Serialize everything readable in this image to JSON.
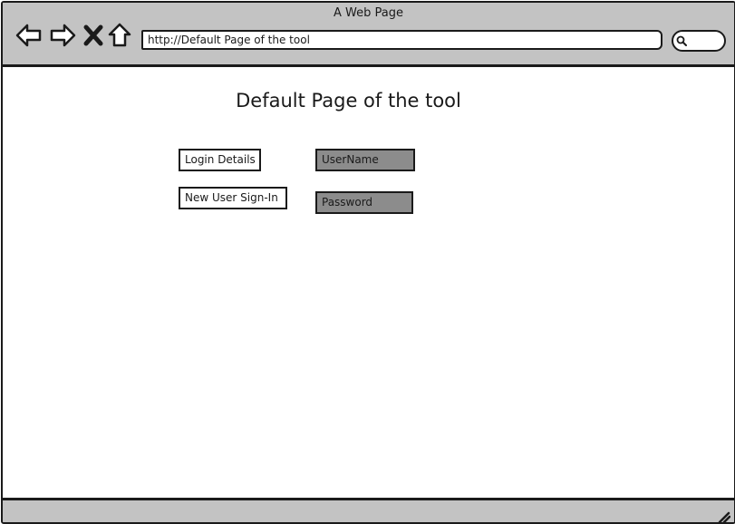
{
  "window": {
    "title": "A Web Page"
  },
  "toolbar": {
    "back_icon": "arrow-left-icon",
    "forward_icon": "arrow-right-icon",
    "stop_icon": "close-x-icon",
    "home_icon": "home-icon",
    "address": "http://Default Page of the tool",
    "search_icon": "magnifier-icon"
  },
  "page": {
    "title": "Default Page of the tool",
    "buttons": {
      "login_details": "Login Details",
      "new_user_signin": "New User Sign-In"
    },
    "fields": {
      "username": "UserName",
      "password": "Password"
    }
  },
  "colors": {
    "chrome": "#c3c3c3",
    "field_fill": "#8c8c8c",
    "stroke": "#1a1a1a"
  }
}
